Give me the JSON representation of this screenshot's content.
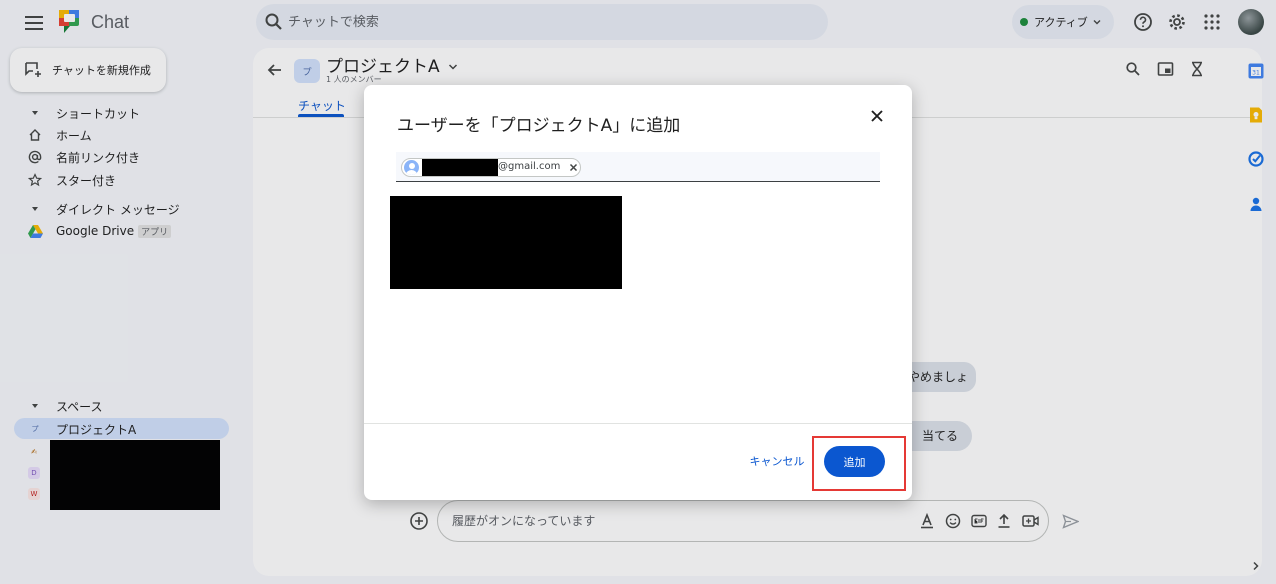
{
  "topbar": {
    "app_name": "Chat",
    "search_placeholder": "チャットで検索",
    "status_label": "アクティブ",
    "status_color": "#1e8e3e"
  },
  "sidebar": {
    "new_chat_label": "チャットを新規作成",
    "shortcuts_header": "ショートカット",
    "shortcuts": [
      {
        "label": "ホーム",
        "icon": "home-icon"
      },
      {
        "label": "名前リンク付き",
        "icon": "at-icon"
      },
      {
        "label": "スター付き",
        "icon": "star-icon"
      }
    ],
    "dm_header": "ダイレクト メッセージ",
    "dm_items": [
      {
        "label": "Google Drive",
        "tag": "アプリ",
        "icon": "google-drive-icon"
      }
    ],
    "spaces_header": "スペース",
    "spaces": [
      {
        "label": "プロジェクトA",
        "initial": "プ",
        "selected": true
      },
      {
        "initial": "✍"
      },
      {
        "initial": "D"
      },
      {
        "initial": "W"
      }
    ]
  },
  "chat": {
    "avatar_initial": "プ",
    "title": "プロジェクトA",
    "subtitle": "1 人のメンバー",
    "tabs": [
      {
        "label": "チャット",
        "active": true
      }
    ],
    "visible_message_fragments": [
      "やめましょ",
      "当てる"
    ],
    "composer_placeholder": "履歴がオンになっています"
  },
  "dialog": {
    "title": "ユーザーを「プロジェクトA」に追加",
    "chip_email_suffix": "@gmail.com",
    "cancel_label": "キャンセル",
    "add_label": "追加",
    "accent_color": "#0b57d0",
    "annotation_color": "#e53935"
  }
}
